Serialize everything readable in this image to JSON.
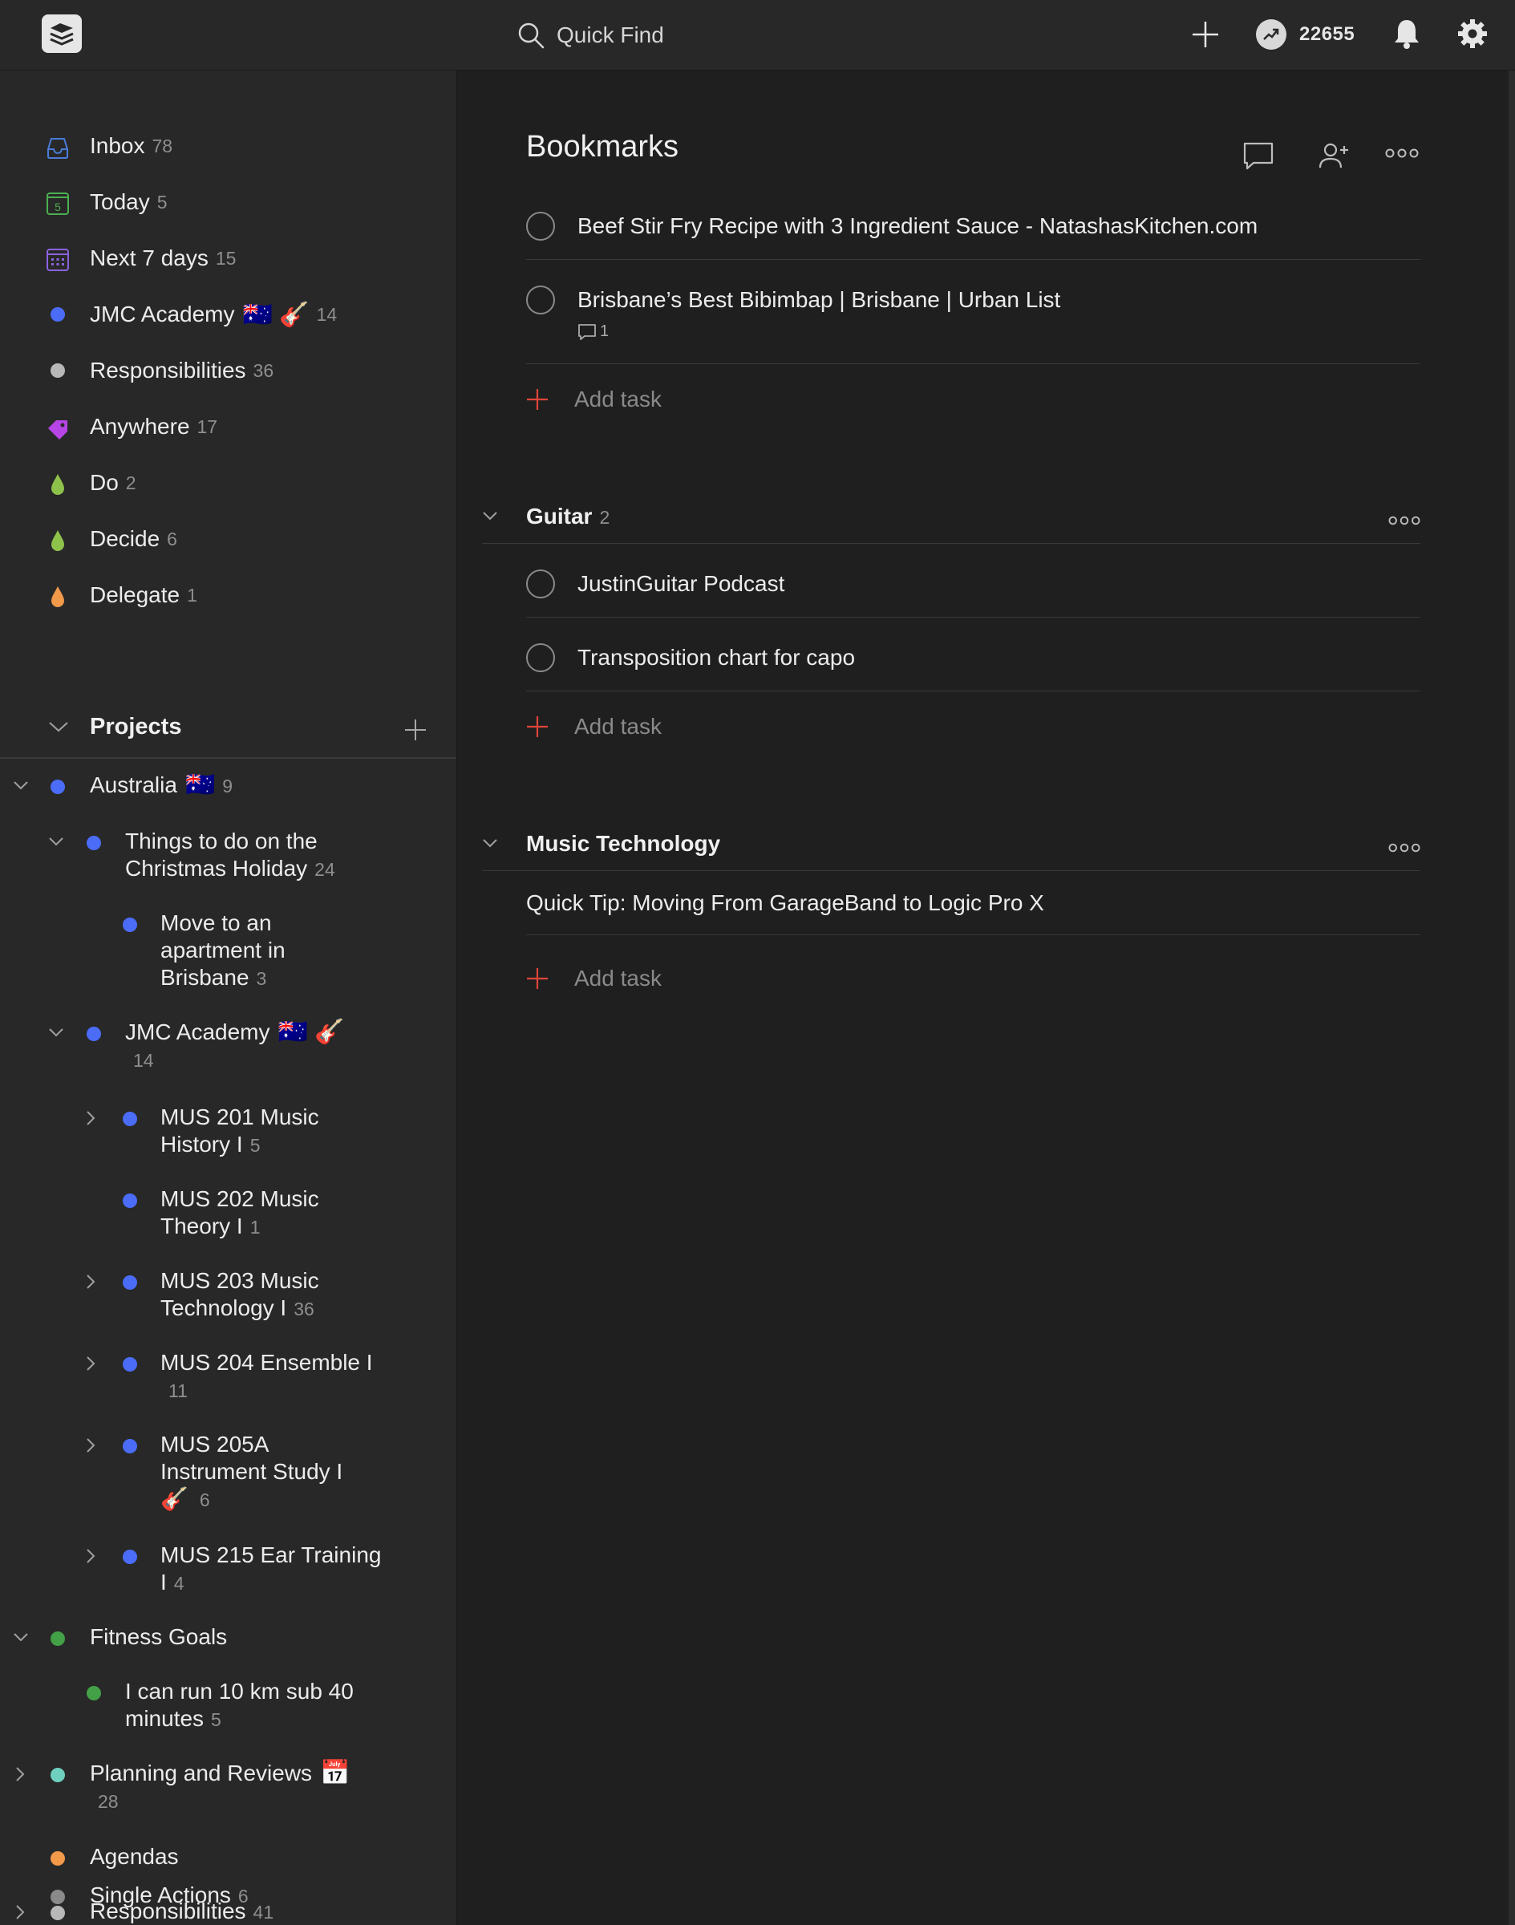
{
  "header": {
    "search_placeholder": "Quick Find",
    "karma_value": "22655"
  },
  "sidebar": {
    "filters": [
      {
        "label": "Inbox",
        "count": "78",
        "icon": "inbox-icon",
        "color": "#4a7bd8"
      },
      {
        "label": "Today",
        "count": "5",
        "icon": "today-calendar-icon",
        "color": "#4caf50",
        "day": "5"
      },
      {
        "label": "Next 7 days",
        "count": "15",
        "icon": "next-week-calendar-icon",
        "color": "#8b63e0"
      },
      {
        "label": "JMC Academy",
        "emoji": "🇦🇺 🎸",
        "count": "14",
        "icon": "blue-dot",
        "color": "#4a6cf7"
      },
      {
        "label": "Responsibilities",
        "count": "36",
        "icon": "grey-dot",
        "color": "#b8b8b8"
      },
      {
        "label": "Anywhere",
        "count": "17",
        "icon": "label-tag-icon",
        "color": "#b745e6"
      },
      {
        "label": "Do",
        "count": "2",
        "icon": "filter-drop-icon",
        "color": "#8ec24a"
      },
      {
        "label": "Decide",
        "count": "6",
        "icon": "filter-drop-icon",
        "color": "#8ec24a"
      },
      {
        "label": "Delegate",
        "count": "1",
        "icon": "filter-drop-icon",
        "color": "#f2994a"
      }
    ],
    "projects_heading": "Projects",
    "projects": [
      {
        "line1": "Australia",
        "emoji": "🇦🇺",
        "count": "9",
        "color": "#4a6cf7"
      },
      {
        "line1": "Things to do on the",
        "line2": "Christmas Holiday",
        "count": "24",
        "color": "#4a6cf7"
      },
      {
        "line1": "Move to an",
        "line2": "apartment in",
        "line3": "Brisbane",
        "count": "3",
        "color": "#4a6cf7"
      },
      {
        "line1": "JMC Academy",
        "emoji": "🇦🇺 🎸",
        "count": "14",
        "color": "#4a6cf7"
      },
      {
        "line1": "MUS 201 Music",
        "line2": "History I",
        "count": "5",
        "color": "#4a6cf7"
      },
      {
        "line1": "MUS 202 Music",
        "line2": "Theory I",
        "count": "1",
        "color": "#4a6cf7"
      },
      {
        "line1": "MUS 203 Music",
        "line2": "Technology I",
        "count": "36",
        "color": "#4a6cf7"
      },
      {
        "line1": "MUS 204 Ensemble I",
        "count": "11",
        "color": "#4a6cf7"
      },
      {
        "line1": "MUS 205A",
        "line2": "Instrument Study I",
        "emoji": "🎸",
        "count": "6",
        "color": "#4a6cf7"
      },
      {
        "line1": "MUS 215 Ear Training",
        "line2": "I",
        "count": "4",
        "color": "#4a6cf7"
      },
      {
        "line1": "Fitness Goals",
        "color": "#43a047"
      },
      {
        "line1": "I can run 10 km sub 40",
        "line2": "minutes",
        "count": "5",
        "color": "#43a047"
      },
      {
        "line1": "Planning and Reviews",
        "emoji": "📅",
        "count": "28",
        "color": "#6fd0c0"
      },
      {
        "line1": "Agendas",
        "color": "#f2994a"
      },
      {
        "line1": "Responsibilities",
        "count": "41",
        "color": "#b8b8b8"
      },
      {
        "line1": "Single Actions",
        "count": "6",
        "color": "#8a8a8a"
      }
    ]
  },
  "main": {
    "title": "Bookmarks",
    "tasks": [
      {
        "label": "Beef Stir Fry Recipe with 3 Ingredient Sauce - NatashasKitchen.com"
      },
      {
        "label": "Brisbane’s Best Bibimbap | Brisbane | Urban List",
        "comments": "1"
      }
    ],
    "add_task_label": "Add task",
    "sections": [
      {
        "title": "Guitar",
        "count": "2",
        "tasks": [
          {
            "label": "JustinGuitar Podcast"
          },
          {
            "label": "Transposition chart for capo"
          }
        ]
      },
      {
        "title": "Music Technology",
        "tasks": [
          {
            "label": "Quick Tip: Moving From GarageBand to Logic Pro X"
          }
        ]
      }
    ]
  },
  "colors": {
    "accent_red": "#e0453a",
    "background": "#1f1f1f",
    "sidebar": "#282828"
  }
}
